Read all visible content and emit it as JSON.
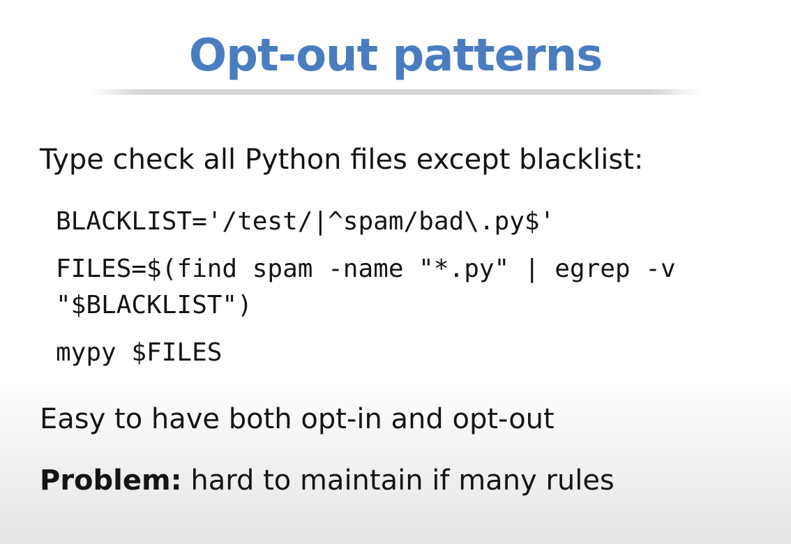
{
  "slide": {
    "title": "Opt-out patterns",
    "intro": "Type check all Python files except blacklist:",
    "code": {
      "line1": "BLACKLIST='/test/|^spam/bad\\.py$'",
      "line2a": "FILES=$(find spam -name \"*.py\" | egrep -v",
      "line2b": "\"$BLACKLIST\")",
      "line3": "mypy $FILES"
    },
    "note": "Easy to have both opt-in and opt-out",
    "problem": {
      "lead": "Problem:",
      "text": " hard to maintain if many rules"
    }
  },
  "colors": {
    "title": "#4a7cc0",
    "text": "#141414",
    "background": "#ffffff"
  }
}
